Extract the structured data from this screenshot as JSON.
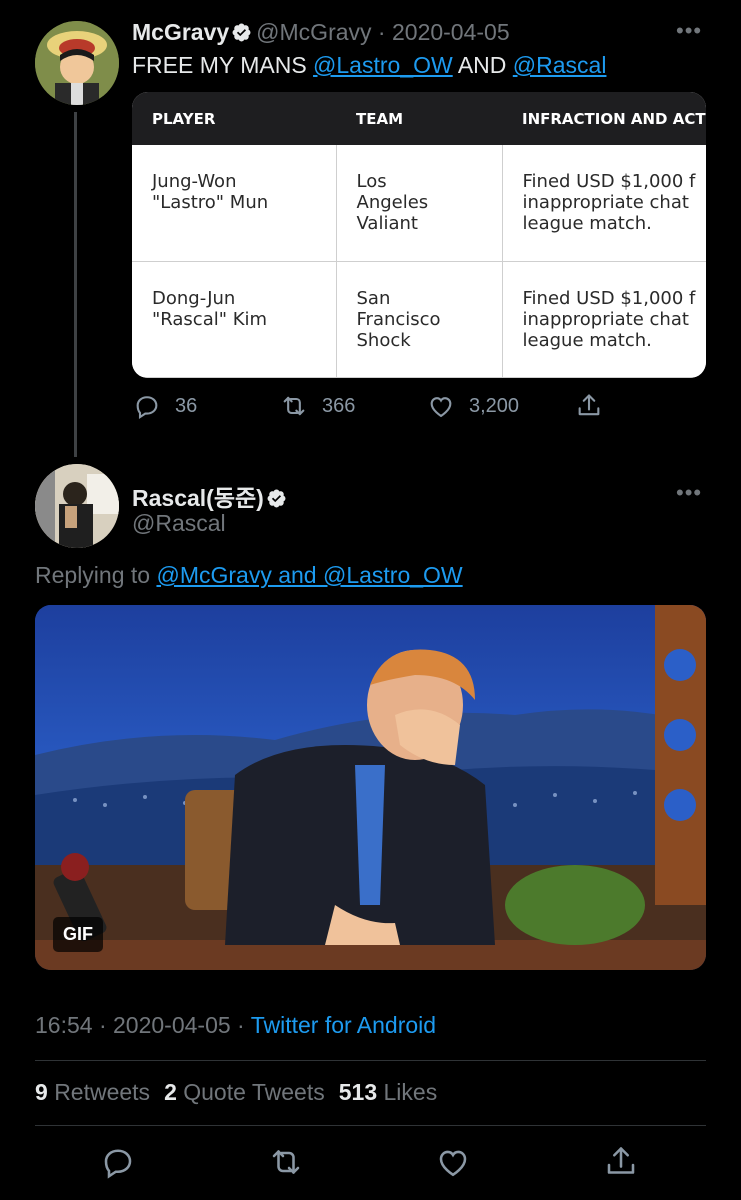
{
  "tweet1": {
    "name": "McGravy",
    "handle": "@McGravy",
    "date": "2020-04-05",
    "text_prefix": "FREE MY MANS ",
    "mention1": "@Lastro_OW",
    "text_and": " AND ",
    "mention2": "@Rascal",
    "table": {
      "headers": [
        "PLAYER",
        "TEAM",
        "INFRACTION AND ACT"
      ],
      "rows": [
        {
          "player": [
            "Jung-Won",
            "\"Lastro\" Mun"
          ],
          "team": [
            "Los",
            "Angeles",
            "Valiant"
          ],
          "infraction": [
            "Fined USD $1,000 f",
            "inappropriate chat",
            "league match."
          ]
        },
        {
          "player": [
            "Dong-Jun",
            "\"Rascal\" Kim"
          ],
          "team": [
            "San",
            "Francisco",
            "Shock"
          ],
          "infraction": [
            "Fined USD $1,000 f",
            "inappropriate chat",
            "league match."
          ]
        }
      ]
    },
    "actions": {
      "replies": "36",
      "retweets": "366",
      "likes": "3,200"
    }
  },
  "tweet2": {
    "name": "Rascal(동준)",
    "handle": "@Rascal",
    "replying_prefix": "Replying to ",
    "replying_to": "@McGravy and @Lastro_OW",
    "gif_badge": "GIF",
    "time": "16:54",
    "date": "2020-04-05",
    "source": "Twitter for Android",
    "stats": {
      "retweets_count": "9",
      "retweets_label": "Retweets",
      "quotes_count": "2",
      "quotes_label": "Quote Tweets",
      "likes_count": "513",
      "likes_label": "Likes"
    }
  },
  "icons": [
    "reply-icon",
    "retweet-icon",
    "like-icon",
    "share-icon",
    "more-icon",
    "verified-badge-icon"
  ],
  "colors": {
    "background": "#000000",
    "accent": "#1d9bf0",
    "muted": "#71767b",
    "text": "#e7e9ea"
  }
}
